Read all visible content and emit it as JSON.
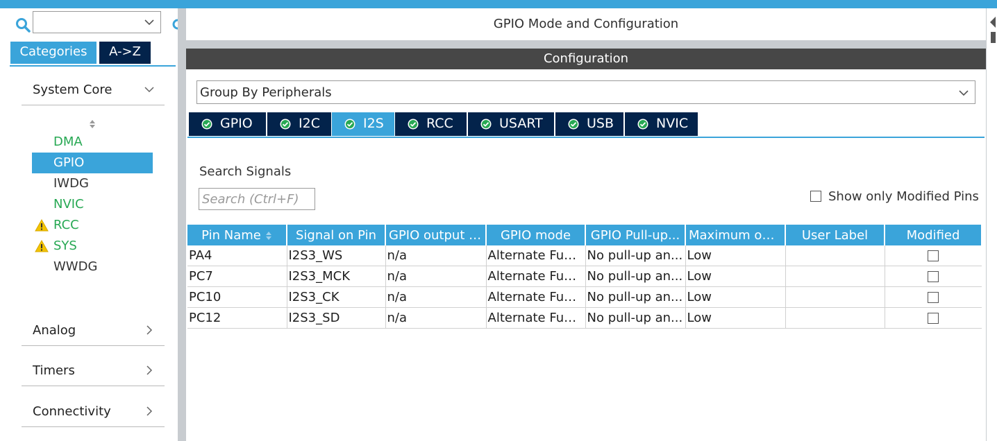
{
  "left_panel": {
    "search": {
      "value": ""
    },
    "tabs": [
      {
        "label": "Categories",
        "active": true
      },
      {
        "label": "A->Z",
        "active": false
      }
    ],
    "categories": [
      {
        "label": "System Core",
        "expanded": true
      },
      {
        "label": "Analog",
        "expanded": false
      },
      {
        "label": "Timers",
        "expanded": false
      },
      {
        "label": "Connectivity",
        "expanded": false
      }
    ],
    "system_core_items": [
      {
        "label": "DMA",
        "state": "ok",
        "warning": false,
        "selected": false
      },
      {
        "label": "GPIO",
        "state": "ok",
        "warning": false,
        "selected": true
      },
      {
        "label": "IWDG",
        "state": "neutral",
        "warning": false,
        "selected": false
      },
      {
        "label": "NVIC",
        "state": "ok",
        "warning": false,
        "selected": false
      },
      {
        "label": "RCC",
        "state": "ok",
        "warning": true,
        "selected": false
      },
      {
        "label": "SYS",
        "state": "ok",
        "warning": true,
        "selected": false
      },
      {
        "label": "WWDG",
        "state": "neutral",
        "warning": false,
        "selected": false
      }
    ]
  },
  "main": {
    "mode_title": "GPIO Mode and Configuration",
    "config_title": "Configuration",
    "group_by": "Group By Peripherals",
    "peripheral_tabs": [
      {
        "label": "GPIO",
        "active": false
      },
      {
        "label": "I2C",
        "active": false
      },
      {
        "label": "I2S",
        "active": true
      },
      {
        "label": "RCC",
        "active": false
      },
      {
        "label": "USART",
        "active": false
      },
      {
        "label": "USB",
        "active": false
      },
      {
        "label": "NVIC",
        "active": false
      }
    ],
    "search_signals_label": "Search Signals",
    "search_signals_placeholder": "Search (Ctrl+F)",
    "show_modified_label": "Show only Modified Pins",
    "show_modified_checked": false,
    "table": {
      "columns": [
        "Pin Name",
        "Signal on Pin",
        "GPIO output l...",
        "GPIO mode",
        "GPIO Pull-up...",
        "Maximum out...",
        "User Label",
        "Modified"
      ],
      "rows": [
        {
          "pin": "PA4",
          "signal": "I2S3_WS",
          "output_level": "n/a",
          "mode": "Alternate Fun...",
          "pull": "No pull-up an...",
          "max_speed": "Low",
          "user_label": "",
          "modified": false
        },
        {
          "pin": "PC7",
          "signal": "I2S3_MCK",
          "output_level": "n/a",
          "mode": "Alternate Fun...",
          "pull": "No pull-up an...",
          "max_speed": "Low",
          "user_label": "",
          "modified": false
        },
        {
          "pin": "PC10",
          "signal": "I2S3_CK",
          "output_level": "n/a",
          "mode": "Alternate Fun...",
          "pull": "No pull-up an...",
          "max_speed": "Low",
          "user_label": "",
          "modified": false
        },
        {
          "pin": "PC12",
          "signal": "I2S3_SD",
          "output_level": "n/a",
          "mode": "Alternate Fun...",
          "pull": "No pull-up an...",
          "max_speed": "Low",
          "user_label": "",
          "modified": false
        }
      ]
    }
  },
  "colors": {
    "accent": "#3aa4da",
    "navy": "#03234b",
    "ok_green": "#27a853",
    "warning_yellow": "#f2c300",
    "config_bar": "#474747"
  },
  "icons": {
    "search": "search-icon",
    "dropdown": "chevron-down-icon",
    "collapsed": "chevron-right-icon",
    "sort": "sort-icon",
    "warning": "warning-icon",
    "tab_status": "check-circle-icon"
  }
}
